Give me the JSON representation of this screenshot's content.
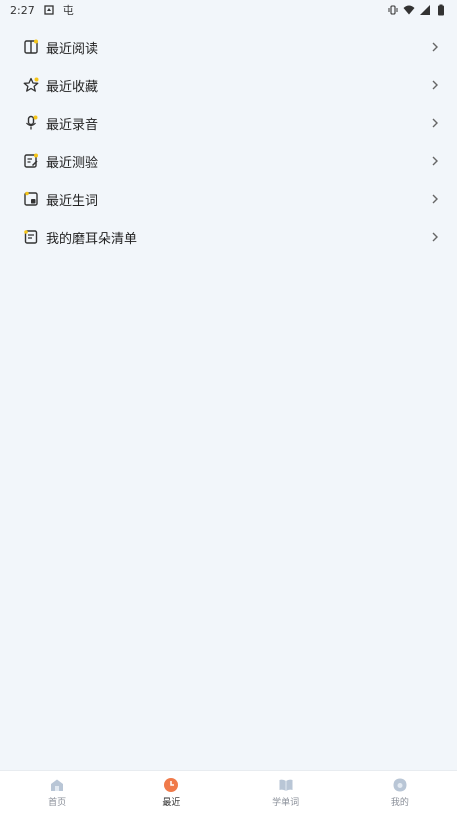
{
  "status_bar": {
    "time": "2:27",
    "carrier_glyph": "屯"
  },
  "menu": {
    "items": [
      {
        "label": "最近阅读",
        "icon": "book-icon"
      },
      {
        "label": "最近收藏",
        "icon": "star-icon"
      },
      {
        "label": "最近录音",
        "icon": "microphone-icon"
      },
      {
        "label": "最近测验",
        "icon": "quiz-icon"
      },
      {
        "label": "最近生词",
        "icon": "vocabulary-card-icon"
      },
      {
        "label": "我的磨耳朵清单",
        "icon": "list-icon"
      }
    ]
  },
  "bottom_nav": {
    "items": [
      {
        "label": "首页",
        "icon": "home-icon",
        "active": false
      },
      {
        "label": "最近",
        "icon": "clock-icon",
        "active": true
      },
      {
        "label": "学单词",
        "icon": "wordbook-icon",
        "active": false
      },
      {
        "label": "我的",
        "icon": "profile-icon",
        "active": false
      }
    ]
  },
  "colors": {
    "background": "#f2f6fa",
    "accent_yellow": "#f5c518",
    "active_orange": "#f07a4a",
    "inactive_icon": "#b9c6d6"
  }
}
